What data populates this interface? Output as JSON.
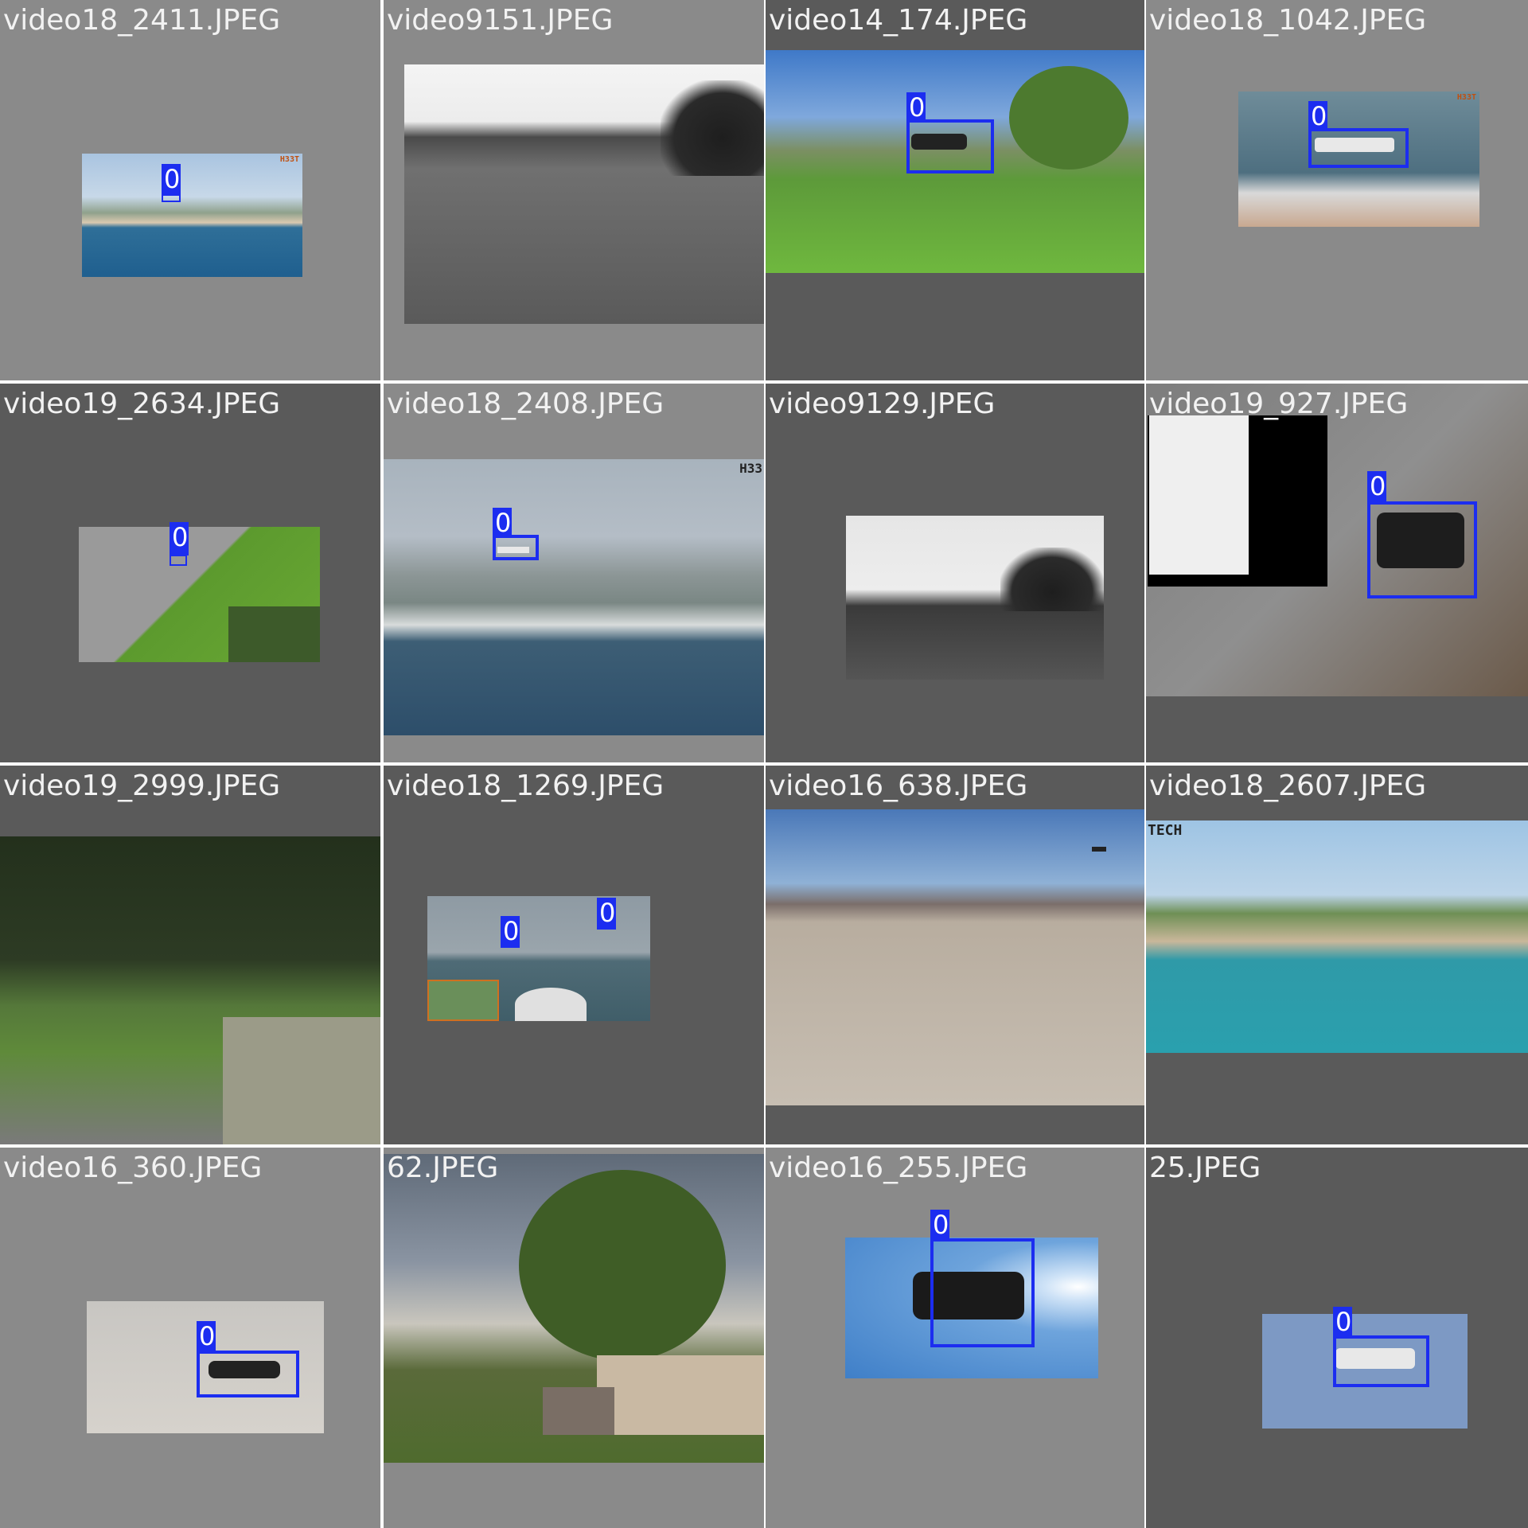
{
  "grid": {
    "tiles": [
      {
        "filename": "video18_2411.JPEG",
        "class_label": "0"
      },
      {
        "filename": "video9151.JPEG"
      },
      {
        "filename": "video14_174.JPEG",
        "class_label": "0"
      },
      {
        "filename": "video18_1042.JPEG",
        "class_label": "0"
      },
      {
        "filename": "video19_2634.JPEG",
        "class_label": "0"
      },
      {
        "filename": "video18_2408.JPEG",
        "class_label": "0"
      },
      {
        "filename": "video9129.JPEG"
      },
      {
        "filename": "video19_927.JPEG",
        "class_label": "0"
      },
      {
        "filename": "video19_2999.JPEG"
      },
      {
        "filename": "video18_1269.JPEG",
        "class_label": "0",
        "class_label_2": "0"
      },
      {
        "filename": "video16_638.JPEG"
      },
      {
        "filename": "video18_2607.JPEG",
        "watermark": "TECH"
      },
      {
        "filename": "video16_360.JPEG",
        "class_label": "0"
      },
      {
        "filename": "62.JPEG"
      },
      {
        "filename": "video16_255.JPEG",
        "class_label": "0"
      },
      {
        "filename": "25.JPEG",
        "class_label": "0"
      }
    ]
  },
  "colors": {
    "bbox": "#1c2df0",
    "label_text": "#f2f2f2",
    "tile_bg_light": "#8a8a8a",
    "tile_bg_dark": "#5a5a5a"
  }
}
